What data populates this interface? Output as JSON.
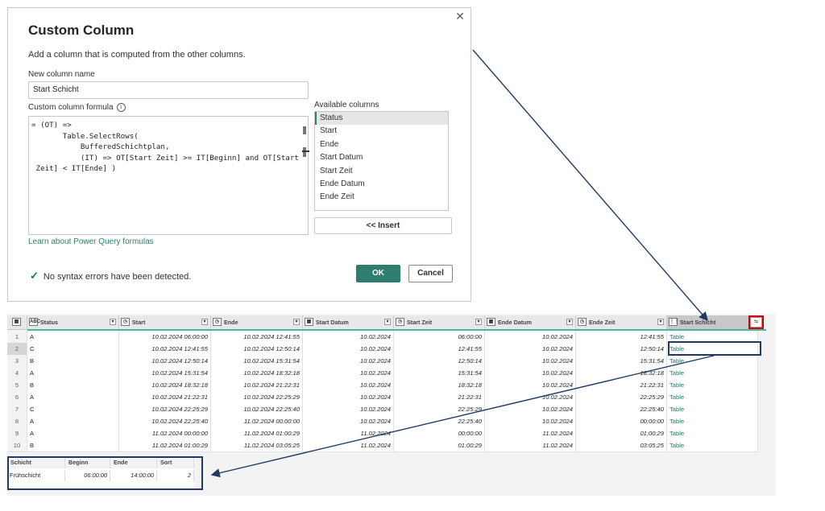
{
  "dialog": {
    "title": "Custom Column",
    "description": "Add a column that is computed from the other columns.",
    "new_column_label": "New column name",
    "new_column_value": "Start Schicht",
    "formula_label": "Custom column formula",
    "formula": "= (OT) =>\n       Table.SelectRows(\n           BufferedSchichtplan,\n           (IT) => OT[Start Zeit] >= IT[Beginn] and OT[Start\n Zeit] < IT[Ende] )",
    "available_label": "Available columns",
    "available_columns": [
      "Status",
      "Start",
      "Ende",
      "Start Datum",
      "Start Zeit",
      "Ende Datum",
      "Ende Zeit"
    ],
    "insert_label": "<< Insert",
    "learn_link": "Learn about Power Query formulas",
    "syntax_status": "No syntax errors have been detected.",
    "ok_label": "OK",
    "cancel_label": "Cancel",
    "close_glyph": "✕"
  },
  "grid": {
    "headers": [
      {
        "type": "ABC",
        "name": "Status"
      },
      {
        "type": "◷",
        "name": "Start"
      },
      {
        "type": "◷",
        "name": "Ende"
      },
      {
        "type": "▦",
        "name": "Start Datum"
      },
      {
        "type": "◷",
        "name": "Start Zeit"
      },
      {
        "type": "▦",
        "name": "Ende Datum"
      },
      {
        "type": "◷",
        "name": "Ende Zeit"
      },
      {
        "type": "⋮⋮",
        "name": "Start Schicht"
      }
    ],
    "rows": [
      [
        "1",
        "A",
        "10.02.2024 06:00:00",
        "10.02.2024 12:41:55",
        "10.02.2024",
        "06:00:00",
        "10.02.2024",
        "12:41:55",
        "Table"
      ],
      [
        "2",
        "C",
        "10.02.2024 12:41:55",
        "10.02.2024 12:50:14",
        "10.02.2024",
        "12:41:55",
        "10.02.2024",
        "12:50:14",
        "Table"
      ],
      [
        "3",
        "B",
        "10.02.2024 12:50:14",
        "10.02.2024 15:31:54",
        "10.02.2024",
        "12:50:14",
        "10.02.2024",
        "15:31:54",
        "Table"
      ],
      [
        "4",
        "A",
        "10.02.2024 15:31:54",
        "10.02.2024 18:32:18",
        "10.02.2024",
        "15:31:54",
        "10.02.2024",
        "18:32:18",
        "Table"
      ],
      [
        "5",
        "B",
        "10.02.2024 18:32:18",
        "10.02.2024 21:22:31",
        "10.02.2024",
        "18:32:18",
        "10.02.2024",
        "21:22:31",
        "Table"
      ],
      [
        "6",
        "A",
        "10.02.2024 21:22:31",
        "10.02.2024 22:25:29",
        "10.02.2024",
        "21:22:31",
        "10.02.2024",
        "22:25:29",
        "Table"
      ],
      [
        "7",
        "C",
        "10.02.2024 22:25:29",
        "10.02.2024 22:25:40",
        "10.02.2024",
        "22:25:29",
        "10.02.2024",
        "22:25:40",
        "Table"
      ],
      [
        "8",
        "A",
        "10.02.2024 22:25:40",
        "11.02.2024 00:00:00",
        "10.02.2024",
        "22:25:40",
        "10.02.2024",
        "00:00:00",
        "Table"
      ],
      [
        "9",
        "A",
        "11.02.2024 00:00:00",
        "11.02.2024 01:00:29",
        "11.02.2024",
        "00:00:00",
        "11.02.2024",
        "01:00:29",
        "Table"
      ],
      [
        "10",
        "B",
        "11.02.2024 01:00:29",
        "11.02.2024 03:05:25",
        "11.02.2024",
        "01:00:29",
        "11.02.2024",
        "03:05:25",
        "Table"
      ]
    ]
  },
  "preview": {
    "headers": [
      "Schicht",
      "Beginn",
      "Ende",
      "Sort"
    ],
    "row": [
      "Frühschicht",
      "06:00:00",
      "14:00:00",
      "2"
    ]
  },
  "colors": {
    "accent": "#2e7d6e",
    "highlight_red": "#d40000",
    "arrow": "#203864",
    "teal_line": "#4ab7a4"
  }
}
